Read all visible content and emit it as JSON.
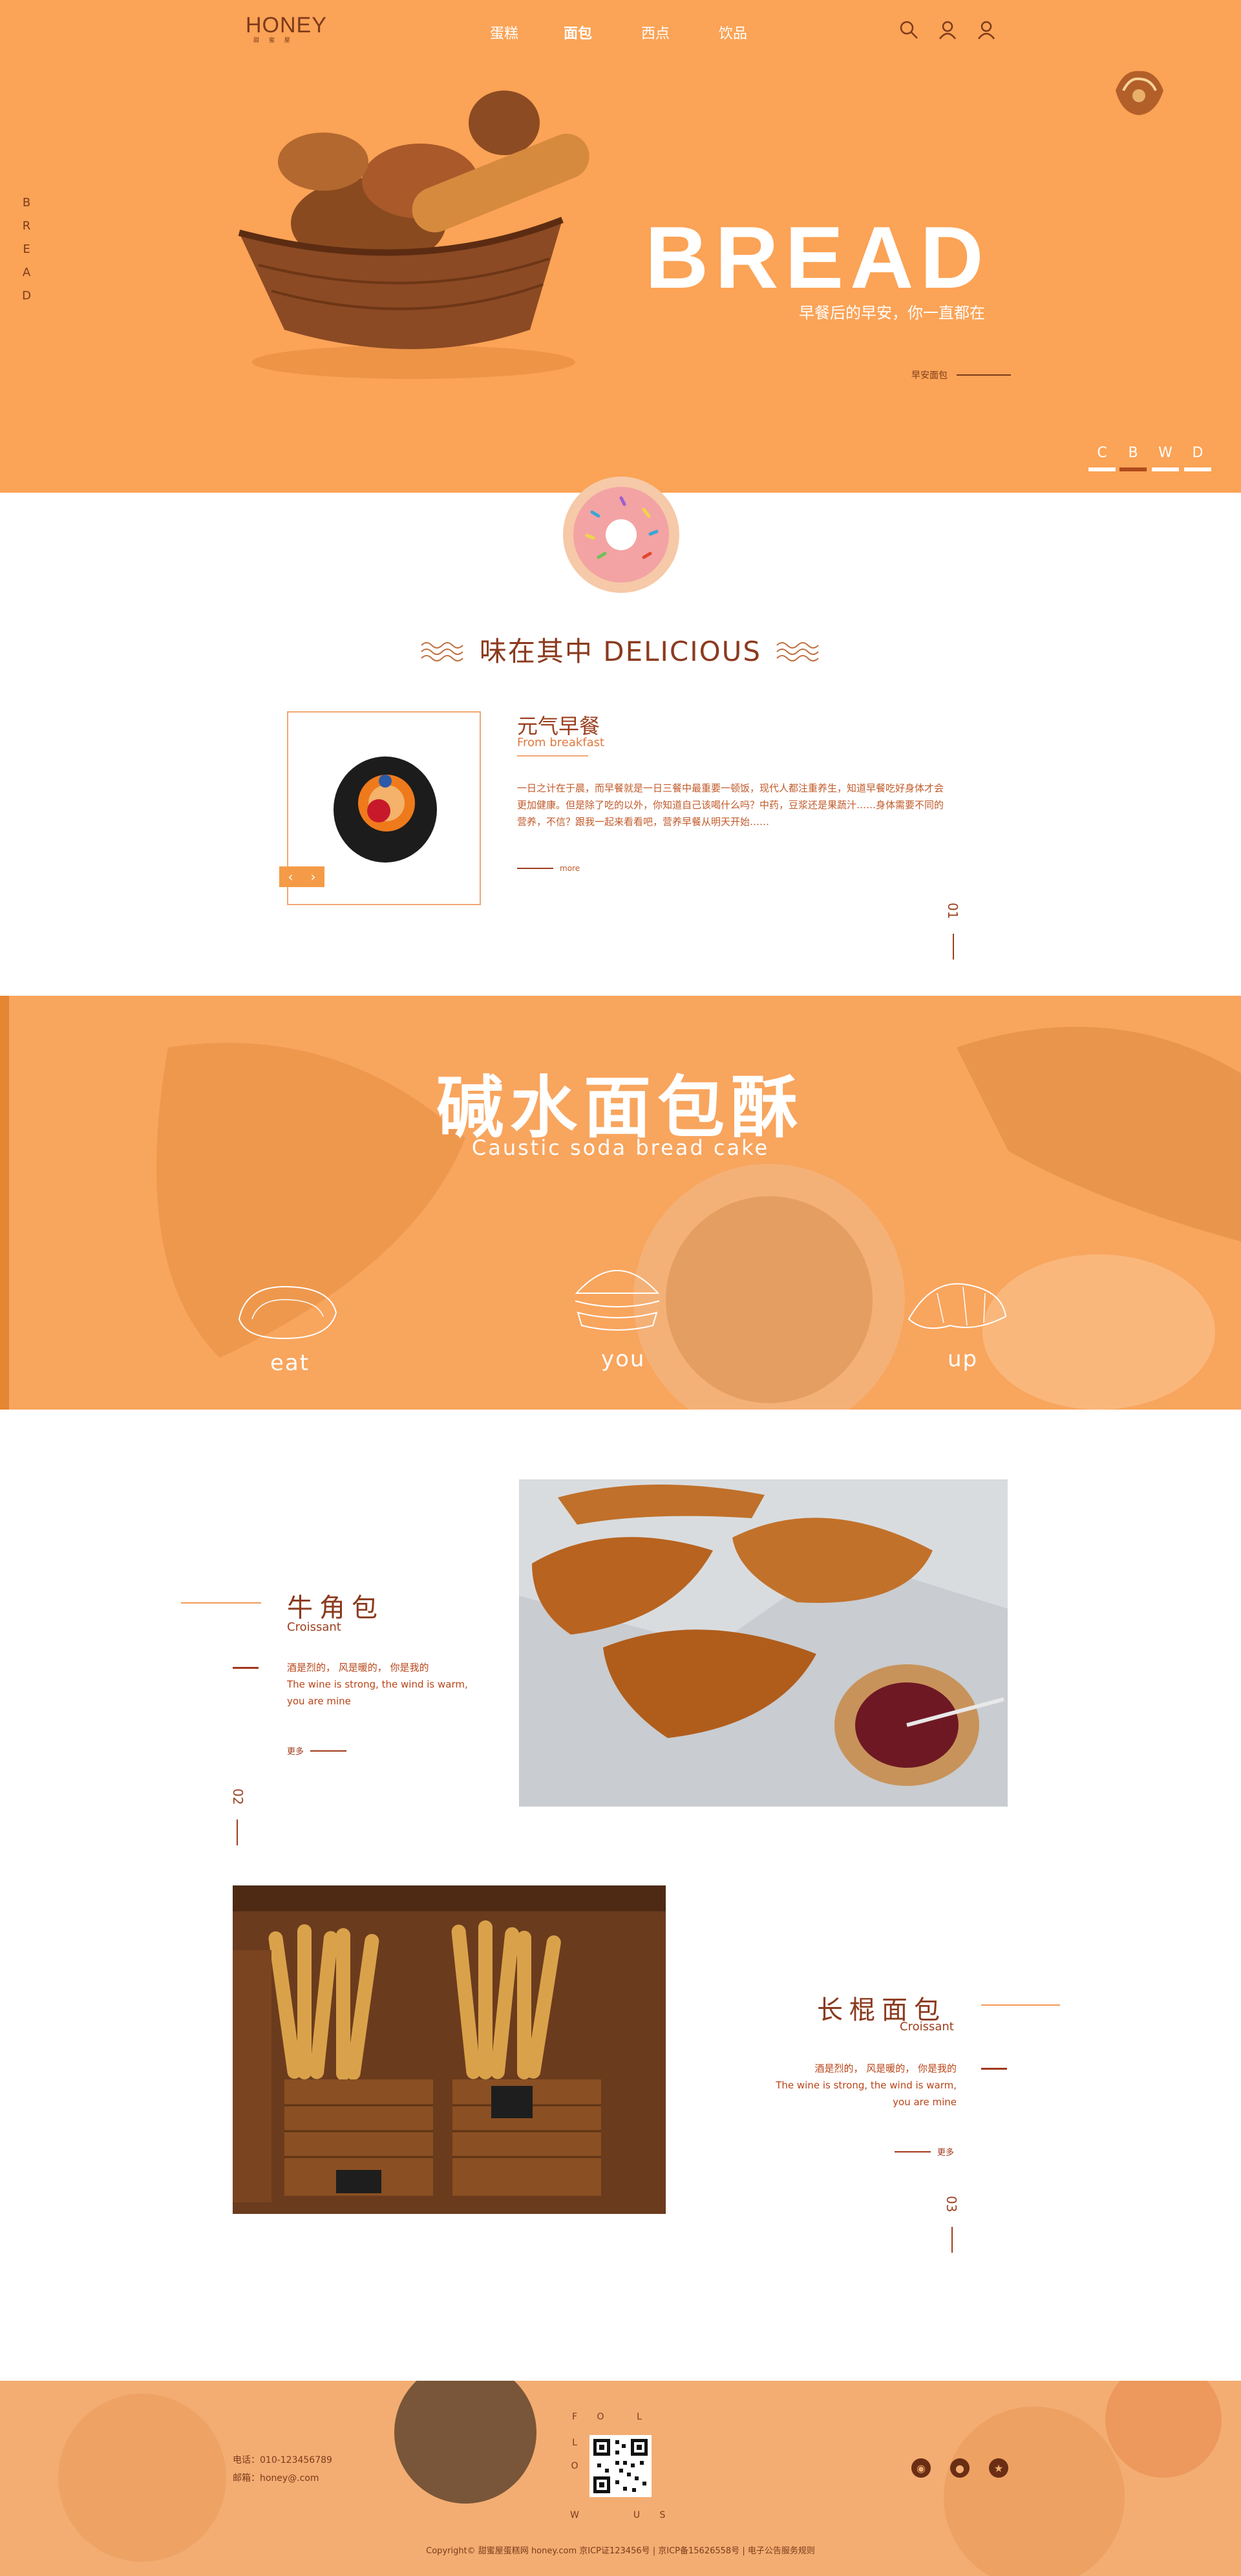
{
  "header": {
    "logo_text": "HONEY",
    "logo_sub": "甜 蜜 屋",
    "nav": [
      "蛋糕",
      "面包",
      "西点",
      "饮品"
    ],
    "active_nav": 1
  },
  "hero": {
    "side_letters": [
      "B",
      "R",
      "E",
      "A",
      "D"
    ],
    "title": "BREAD",
    "subtitle": "早餐后的早安，你一直都在",
    "more_label": "早安面包",
    "tabs": [
      "C",
      "B",
      "W",
      "D"
    ],
    "active_tab": 1
  },
  "delicious": {
    "title": "味在其中 DELICIOUS",
    "item_title": "元气早餐",
    "item_sub": "From breakfast",
    "item_desc": "一日之计在于晨，而早餐就是一日三餐中最重要一顿饭，现代人都注重养生，知道早餐吃好身体才会更加健康。但是除了吃的以外，你知道自己该喝什么吗？中药，豆浆还是果蔬汁……身体需要不同的营养，不信？跟我一起来看看吧，营养早餐从明天开始……",
    "more_label": "more",
    "prev": "‹",
    "next": "›",
    "index": "01"
  },
  "banner": {
    "title": "碱水面包酥",
    "subtitle": "Caustic soda bread cake",
    "words": [
      "eat",
      "you",
      "up"
    ]
  },
  "products": [
    {
      "title": "牛角包",
      "sub": "Croissant",
      "desc1": "酒是烈的， 风是暖的， 你是我的",
      "desc2": "The wine is strong, the wind is warm,",
      "desc3": "you are mine",
      "more_label": "更多",
      "index": "02"
    },
    {
      "title": "长棍面包",
      "sub": "Croissant",
      "desc1": "酒是烈的， 风是暖的， 你是我的",
      "desc2": "The wine is strong, the wind is warm,",
      "desc3": "you are mine",
      "more_label": "更多",
      "index": "03"
    }
  ],
  "footer": {
    "phone": "电话：010-123456789",
    "email": "邮箱：honey@.com",
    "follow_letters": [
      "F",
      "O",
      "L",
      "L",
      "O",
      "W",
      "U",
      "S"
    ],
    "social": [
      "weibo-icon",
      "qq-icon",
      "star-icon"
    ],
    "copyright": "Copyright© 甜蜜屋蛋糕网 honey.com 京ICP证123456号 | 京ICP备15626558号 | 电子公告服务规则"
  },
  "colors": {
    "brand_orange": "#fba356",
    "brand_brown": "#8b3a1e",
    "accent": "#f59b47"
  }
}
